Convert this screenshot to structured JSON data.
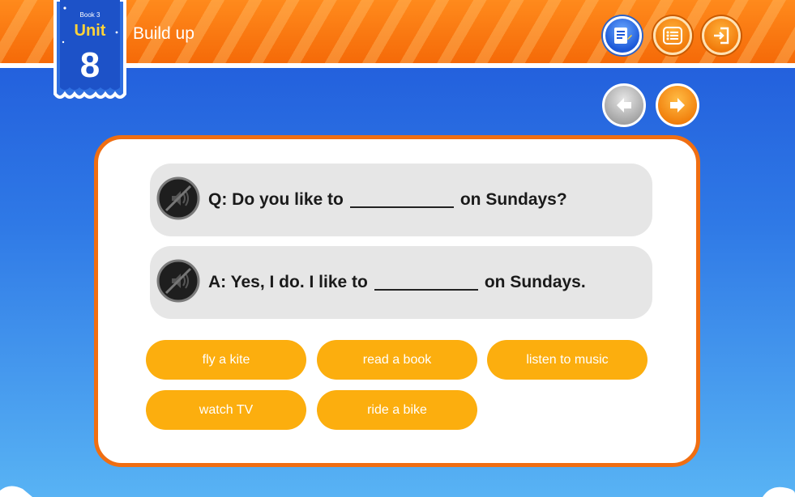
{
  "header": {
    "title": "Build up",
    "badge": {
      "book": "Book 3",
      "unit": "Unit",
      "number": "8"
    }
  },
  "toolbar": {
    "icons": [
      "notes-icon",
      "menu-icon",
      "exit-icon"
    ]
  },
  "navigation": {
    "prev_icon": "arrow-left-icon",
    "next_icon": "arrow-right-icon"
  },
  "exercise": {
    "question": {
      "before": "Q: Do you like to",
      "after": "on Sundays?"
    },
    "answer": {
      "before": "A: Yes, I do. I like to",
      "after": "on Sundays."
    },
    "choices": [
      "fly a kite",
      "read a book",
      "listen to music",
      "watch TV",
      "ride a bike"
    ]
  },
  "colors": {
    "header_orange": "#f56a08",
    "background_blue": "#1e56d9",
    "choice_orange": "#fcae0e",
    "card_border": "#f06e12",
    "row_grey": "#e6e6e6"
  }
}
